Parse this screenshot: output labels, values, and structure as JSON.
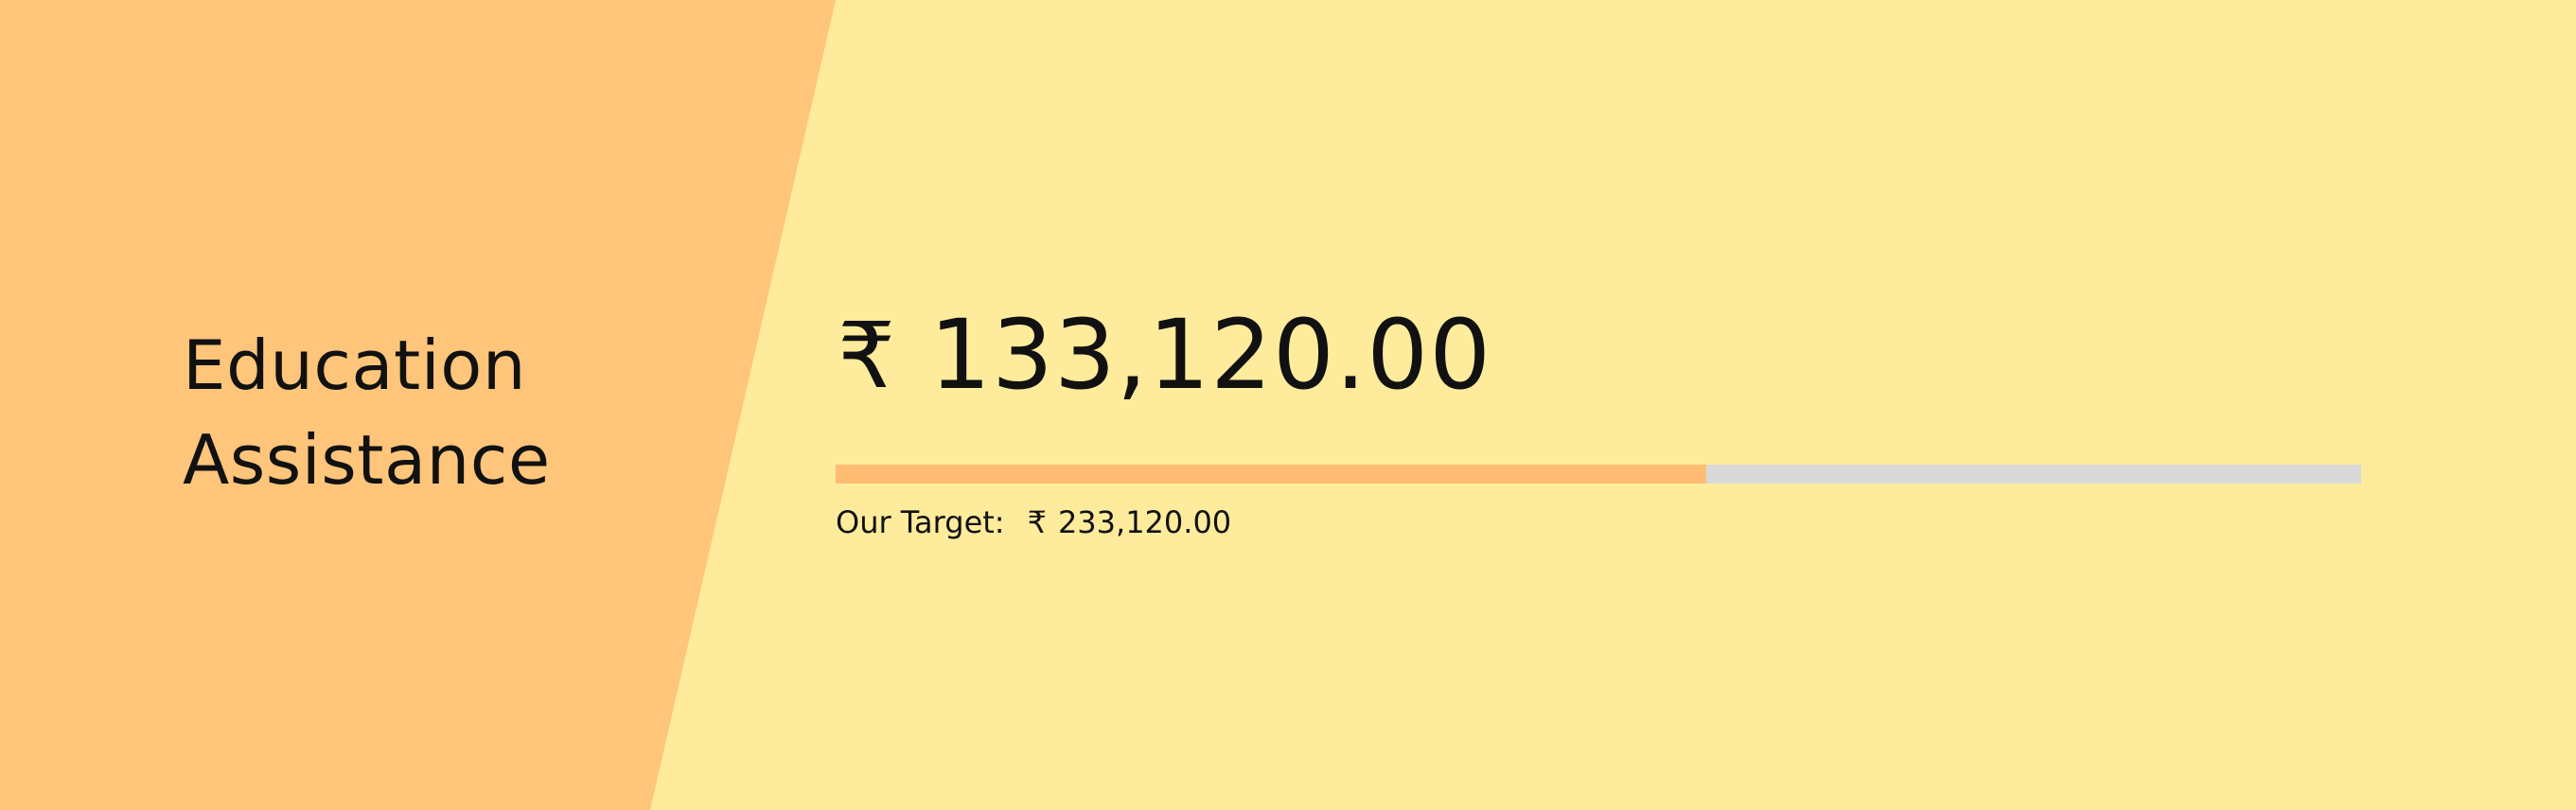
{
  "banner": {
    "title_line_1": "Education",
    "title_line_2": "Assistance",
    "currency_symbol": "₹",
    "raised_amount": "133,120.00",
    "target_label": "Our Target:",
    "target_amount": "233,120.00",
    "progress": 0.571
  },
  "colors": {
    "background": "#ffeb9c",
    "left_panel": "#ffc57a",
    "progress_fill": "#ffbc72",
    "progress_track": "#d9d9d9",
    "text": "#111111"
  }
}
